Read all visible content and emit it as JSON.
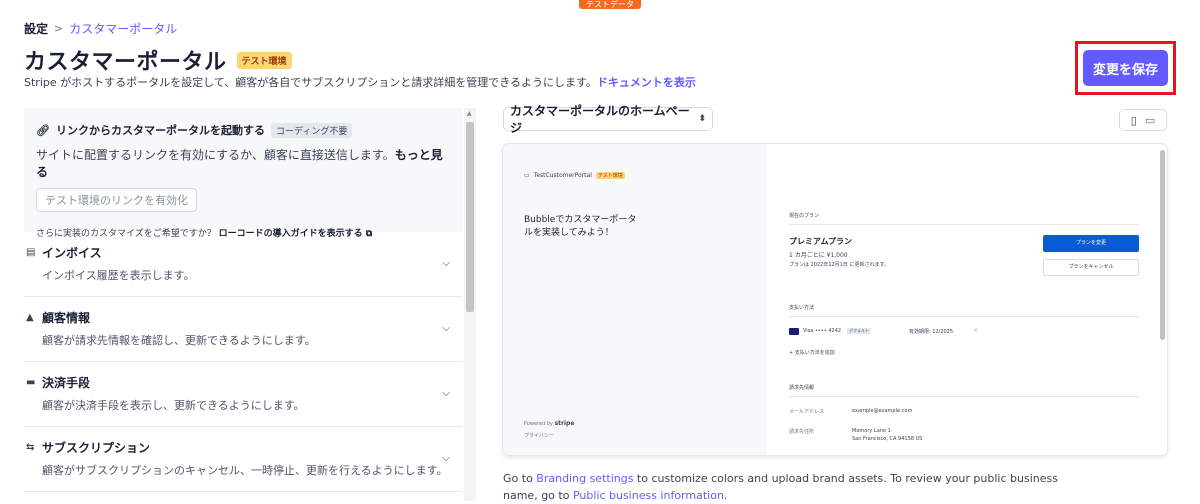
{
  "test_banner": "テストデータ",
  "breadcrumb": {
    "root": "設定",
    "separator": ">",
    "current": "カスタマーポータル"
  },
  "header": {
    "title": "カスタマーポータル",
    "env_badge": "テスト環境",
    "subtitle": "Stripe がホストするポータルを設定して、顧客が各自でサブスクリプションと請求詳細を管理できるようにします。",
    "doc_link": "ドキュメントを表示",
    "save_label": "変更を保存",
    "accent_color": "#635bff",
    "highlight_color": "#e6141e"
  },
  "launch": {
    "icon": "link-icon",
    "title": "リンクからカスタマーポータルを起動する",
    "badge": "コーディング不要",
    "description": "サイトに配置するリンクを有効にするか、顧客に直接送信します。",
    "more": "もっと見る",
    "enable_button": "テスト環境のリンクを有効化",
    "note": "さらに実装のカスタマイズをご希望ですか？",
    "guide_link": "ローコードの導入ガイドを表示する"
  },
  "sections": [
    {
      "icon": "invoice-icon",
      "title": "インボイス",
      "description": "インボイス履歴を表示します。"
    },
    {
      "icon": "user-icon",
      "title": "顧客情報",
      "description": "顧客が請求先情報を確認し、更新できるようにします。"
    },
    {
      "icon": "card-icon",
      "title": "決済手段",
      "description": "顧客が決済手段を表示し、更新できるようにします。"
    },
    {
      "icon": "subscription-icon",
      "title": "サブスクリプション",
      "description": "顧客がサブスクリプションのキャンセル、一時停止、更新を行えるようにします。"
    }
  ],
  "preview": {
    "selector": "カスタマーポータルのホームページ",
    "device_options": [
      "mobile-icon",
      "desktop-icon"
    ],
    "shop_name": "TestCustomerPortal",
    "shop_badge": "テスト環境",
    "promo": "Bubbleでカスタマーポータルを実装してみよう！",
    "powered_by": "Powered by",
    "powered_brand": "stripe",
    "privacy": "プライバシー",
    "current_plan_label": "現在のプラン",
    "plan_name": "プレミアムプラン",
    "plan_price": "1 カ月ごとに ¥1,000",
    "plan_renewal": "プランは 2022年12月1日 に更新されます。",
    "change_plan": "プランを変更",
    "cancel_plan": "プランをキャンセル",
    "payment_label": "支払い方法",
    "card": "Visa •••• 4242",
    "card_default": "デフォルト",
    "card_expiry": "有効期限: 12/2025",
    "card_remove": "×",
    "add_payment": "+ 支払い方法を追加",
    "billing_label": "請求先情報",
    "email_label": "メールアドレス",
    "email_value": "example@example.com",
    "address_label": "請求先住所",
    "address_line1": "Memory Lane 1",
    "address_line2": "San Francisco, CA 94158 US"
  },
  "footer": {
    "text1": "Go to ",
    "link1": "Branding settings",
    "text2": " to customize colors and upload brand assets. To review your public business name, go to ",
    "link2": "Public business information",
    "text3": "."
  }
}
